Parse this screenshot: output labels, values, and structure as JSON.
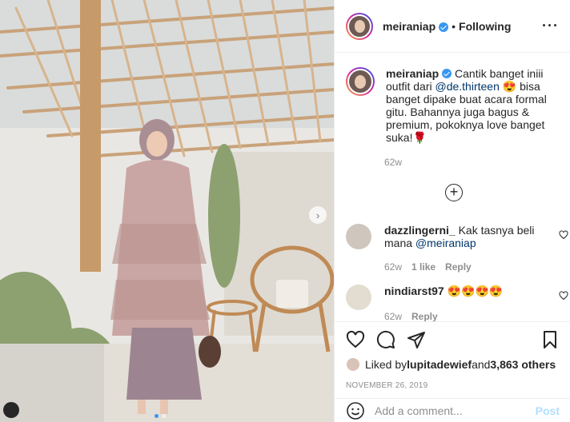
{
  "post": {
    "username": "meiraniap",
    "separator": "•",
    "following_label": "Following",
    "more_label": "···",
    "next_label": "›"
  },
  "caption": {
    "username": "meiraniap",
    "text_part1": " Cantik banget iniii outfit dari ",
    "mention": "@de.thirteen",
    "text_part2": " 😍 bisa banget dipake buat acara formal gitu. Bahannya juga bagus & premium, pokoknya love banget suka!🌹",
    "time": "62w",
    "load_more": "+"
  },
  "comments": [
    {
      "username": "dazzlingerni_",
      "text": " Kak tasnya beli mana ",
      "mention": "@meiraniap",
      "time": "62w",
      "likes": "1 like",
      "reply": "Reply"
    },
    {
      "username": "nindiarst97",
      "text": " 😍😍😍😍",
      "time": "62w",
      "reply": "Reply"
    }
  ],
  "likes": {
    "prefix": "Liked by ",
    "user": "lupitadewief",
    "middle": " and ",
    "count": "3,863 others"
  },
  "date": "NOVEMBER 26, 2019",
  "add_comment": {
    "placeholder": "Add a comment...",
    "post_label": "Post"
  },
  "colors": {
    "accent": "#3897f0",
    "post_disabled": "#b2dffc",
    "meta": "#8e8e8e"
  },
  "carousel": {
    "count": 2,
    "active_index": 0
  }
}
